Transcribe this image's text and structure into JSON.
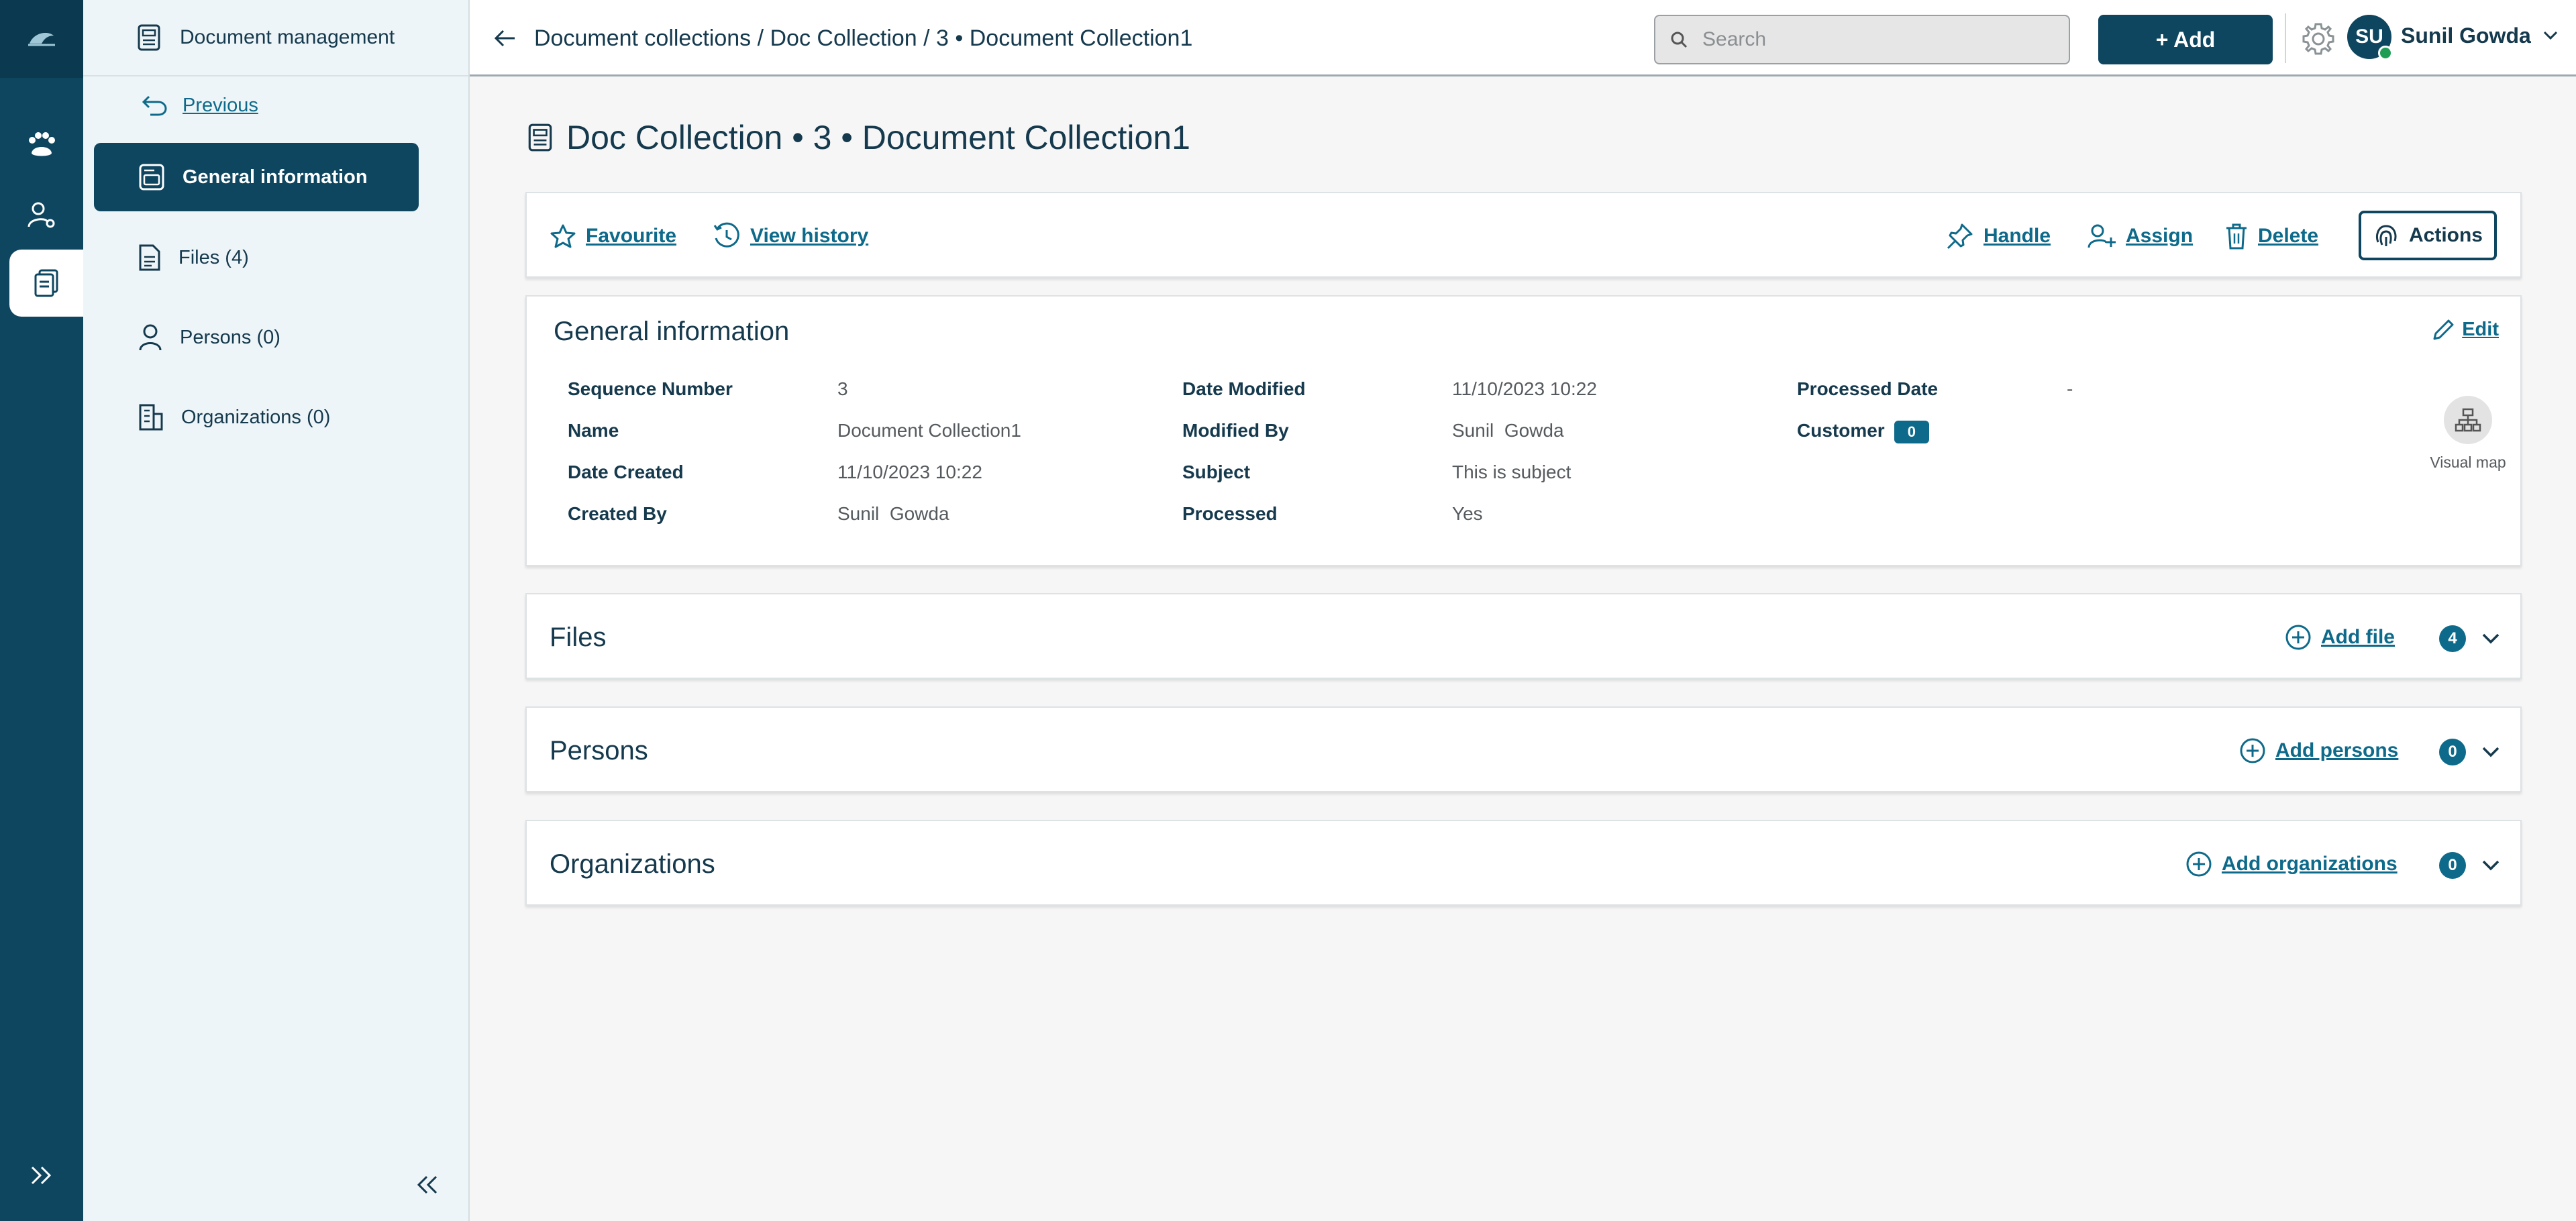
{
  "sidebar": {
    "header": "Document management",
    "previous_label": "Previous",
    "items": [
      {
        "label": "General information"
      },
      {
        "label": "Files (4)"
      },
      {
        "label": "Persons (0)"
      },
      {
        "label": "Organizations (0)"
      }
    ]
  },
  "header": {
    "breadcrumb": "Document collections / Doc Collection / 3 • Document Collection1",
    "search_placeholder": "Search",
    "add_label": "+ Add",
    "user_initials": "SU",
    "user_name": "Sunil Gowda"
  },
  "page": {
    "title": "Doc Collection • 3 • Document Collection1"
  },
  "toolbar": {
    "favourite": "Favourite",
    "view_history": "View history",
    "handle": "Handle",
    "assign": "Assign",
    "delete": "Delete",
    "actions": "Actions"
  },
  "general": {
    "title": "General information",
    "edit_label": "Edit",
    "fields": {
      "sequence_number": {
        "label": "Sequence Number",
        "value": "3"
      },
      "name": {
        "label": "Name",
        "value": "Document Collection1"
      },
      "date_created": {
        "label": "Date Created",
        "value": "11/10/2023 10:22"
      },
      "created_by": {
        "label": "Created By",
        "value": "Sunil  Gowda"
      },
      "date_modified": {
        "label": "Date Modified",
        "value": "11/10/2023 10:22"
      },
      "modified_by": {
        "label": "Modified By",
        "value": "Sunil  Gowda"
      },
      "subject": {
        "label": "Subject",
        "value": "This is subject"
      },
      "processed": {
        "label": "Processed",
        "value": "Yes"
      },
      "processed_date": {
        "label": "Processed Date",
        "value": "-"
      },
      "customer": {
        "label": "Customer",
        "value": "0"
      }
    },
    "visual_map_label": "Visual map"
  },
  "sections": [
    {
      "title": "Files",
      "add_label": "Add file",
      "count": "4"
    },
    {
      "title": "Persons",
      "add_label": "Add persons",
      "count": "0"
    },
    {
      "title": "Organizations",
      "add_label": "Add organizations",
      "count": "0"
    }
  ],
  "colors": {
    "primary": "#0e4660",
    "accent": "#0e6a8a",
    "sidebar_bg": "#eef5f8",
    "page_bg": "#f6f6f6",
    "online": "#1f9d55"
  },
  "icons": {
    "rail": [
      "app-logo-icon",
      "paw-icon",
      "user-settings-icon",
      "documents-icon",
      "double-chevron-right-icon"
    ],
    "sidebar": [
      "document-icon",
      "undo-arrow-icon",
      "info-card-icon",
      "file-icon",
      "person-icon",
      "building-icon",
      "double-chevron-left-icon"
    ]
  }
}
